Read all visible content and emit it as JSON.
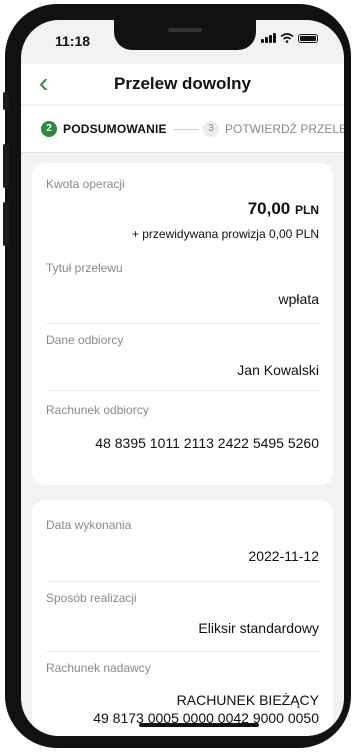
{
  "status_bar": {
    "time": "11:18"
  },
  "header": {
    "back_symbol": "‹",
    "title": "Przelew dowolny"
  },
  "steps": {
    "active": {
      "number": "2",
      "label": "PODSUMOWANIE"
    },
    "next": {
      "number": "3",
      "label": "POTWIERDŹ PRZELEW"
    }
  },
  "summary": {
    "amount_label": "Kwota operacji",
    "amount_value": "70,00",
    "amount_currency": "PLN",
    "commission_text": "+ przewidywana prowizja 0,00 PLN",
    "title_label": "Tytuł przelewu",
    "title_value": "wpłata",
    "recipient_label": "Dane odbiorcy",
    "recipient_value": "Jan Kowalski",
    "recipient_account_label": "Rachunek odbiorcy",
    "recipient_account_value": "48 8395 1011 2113 2422 5495 5260"
  },
  "execution": {
    "date_label": "Data wykonania",
    "date_value": "2022-11-12",
    "method_label": "Sposób realizacji",
    "method_value": "Eliksir standardowy",
    "sender_label": "Rachunek nadawcy",
    "sender_name": "RACHUNEK BIEŻĄCY",
    "sender_number": "49 8173 0005 0000 0042 9000 0050"
  },
  "colors": {
    "accent": "#2e8b3d",
    "background": "#f2f2f2"
  },
  "icons": {
    "back": "chevron-left-icon"
  }
}
